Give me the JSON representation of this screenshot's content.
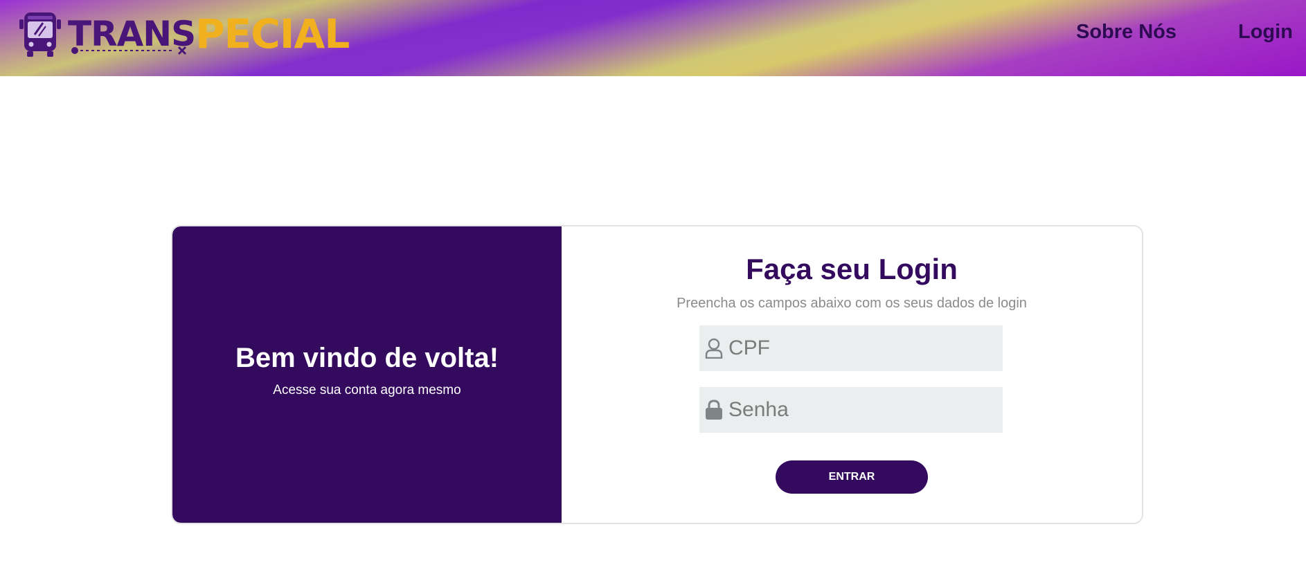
{
  "brand": {
    "name_part1": "TRANS",
    "name_part2": "PECIAL",
    "logo_icon": "bus-icon",
    "accessibility_icon": "wheelchair-icon",
    "colors": {
      "primary_purple": "#330a5e",
      "logo_purple": "#4a1578",
      "logo_yellow": "#f1b11e"
    }
  },
  "nav": {
    "about_label": "Sobre Nós",
    "login_label": "Login"
  },
  "welcome_panel": {
    "title": "Bem vindo de volta!",
    "subtitle": "Acesse sua conta agora mesmo"
  },
  "login_form": {
    "title": "Faça seu Login",
    "subtitle": "Preencha os campos abaixo com os seus dados de login",
    "cpf": {
      "placeholder": "CPF",
      "value": "",
      "icon": "user-icon"
    },
    "password": {
      "placeholder": "Senha",
      "value": "",
      "icon": "lock-icon"
    },
    "submit_label": "ENTRAR"
  }
}
